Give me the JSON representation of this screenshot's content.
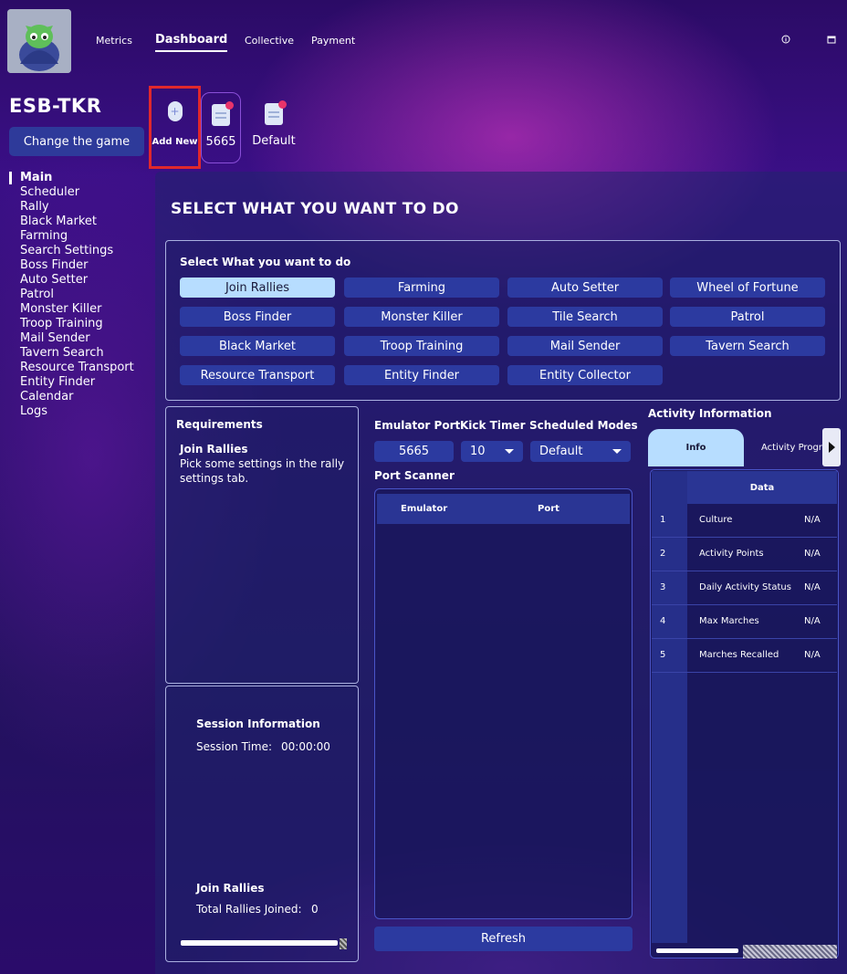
{
  "nav": {
    "links": [
      "Metrics",
      "Dashboard",
      "Collective",
      "Payment"
    ],
    "icons": [
      "info-icon",
      "calendar-icon"
    ]
  },
  "game": {
    "title": "ESB-TKR",
    "change_label": "Change the game"
  },
  "profiles": {
    "add_new_label": "Add New",
    "items": [
      "5665",
      "Default"
    ]
  },
  "sidebar": {
    "items": [
      "Main",
      "Scheduler",
      "Rally",
      "Black Market",
      "Farming",
      "Search Settings",
      "Boss Finder",
      "Auto Setter",
      "Patrol",
      "Monster Killer",
      "Troop Training",
      "Mail Sender",
      "Tavern Search",
      "Resource Transport",
      "Entity Finder",
      "Calendar",
      "Logs"
    ],
    "active": "Main"
  },
  "main": {
    "title": "SELECT WHAT YOU WANT TO DO",
    "task_heading": "Select What you want to do",
    "tasks": [
      "Join Rallies",
      "Farming",
      "Auto Setter",
      "Wheel of Fortune",
      "Boss Finder",
      "Monster Killer",
      "Tile Search",
      "Patrol",
      "Black Market",
      "Troop Training",
      "Mail Sender",
      "Tavern Search",
      "Resource Transport",
      "Entity Finder",
      "Entity Collector"
    ],
    "selected_task": "Join Rallies"
  },
  "requirements": {
    "heading": "Requirements",
    "task": "Join Rallies",
    "desc_line1": "Pick some settings in the rally",
    "desc_line2": "settings tab."
  },
  "session": {
    "heading": "Session Information",
    "time_label": "Session Time:",
    "time_value": "00:00:00",
    "rallies_heading": "Join Rallies",
    "rallies_label": "Total Rallies Joined:",
    "rallies_value": "0"
  },
  "config": {
    "emulator_port_label": "Emulator Port",
    "emulator_port_value": "5665",
    "kick_timer_label": "Kick Timer",
    "kick_timer_value": "10",
    "scheduled_modes_label": "Scheduled Modes",
    "scheduled_modes_value": "Default"
  },
  "port_scanner": {
    "title": "Port Scanner",
    "columns": [
      "Emulator",
      "Port"
    ],
    "refresh_label": "Refresh"
  },
  "activity": {
    "title": "Activity Information",
    "tabs": [
      "Info",
      "Activity Progress"
    ],
    "tab_visible_text": [
      "Info",
      "Activity Progre"
    ],
    "header": "Data",
    "rows": [
      {
        "index": "1",
        "key": "Culture",
        "value": "N/A"
      },
      {
        "index": "2",
        "key": "Activity Points",
        "value": "N/A"
      },
      {
        "index": "3",
        "key": "Daily Activity Status",
        "value": "N/A"
      },
      {
        "index": "4",
        "key": "Max Marches",
        "value": "N/A"
      },
      {
        "index": "5",
        "key": "Marches Recalled",
        "value": "N/A"
      }
    ]
  },
  "colors": {
    "accent_button": "#2c3aa0",
    "selected_button": "#b7ddff",
    "highlight_box": "#e0282c"
  }
}
